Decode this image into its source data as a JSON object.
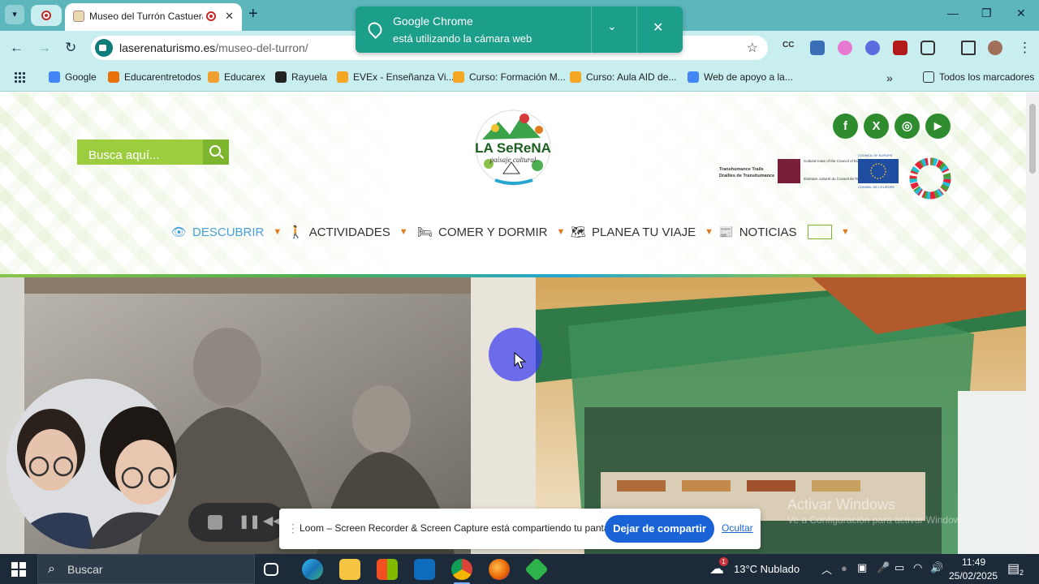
{
  "browser": {
    "active_tab": {
      "title": "Museo del Turrón Castuera"
    },
    "url": {
      "domain": "laserenaturismo.es",
      "path": "/museo-del-turron/"
    },
    "notification": {
      "title": "Google Chrome",
      "text": "está utilizando la cámara web"
    },
    "bookmarks": [
      {
        "label": "Google",
        "color": "#4285f4"
      },
      {
        "label": "Educarentretodos",
        "color": "#e8710a"
      },
      {
        "label": "Educarex",
        "color": "#f0a030"
      },
      {
        "label": "Rayuela",
        "color": "#222222"
      },
      {
        "label": "EVEx - Enseñanza Vi...",
        "color": "#f5a623"
      },
      {
        "label": "Curso: Formación M...",
        "color": "#f5a623"
      },
      {
        "label": "Curso: Aula AID de...",
        "color": "#f5a623"
      },
      {
        "label": "Web de apoyo a la...",
        "color": "#4285f4"
      }
    ],
    "all_bookmarks": "Todos los marcadores"
  },
  "site": {
    "search_placeholder": "Busca aquí...",
    "logo": {
      "line1": "LA SeReNA",
      "line2": "paisaje cultural"
    },
    "partner_text": {
      "trails": "Transhumance Trails",
      "trails_fr": "Drailles de Transhumance",
      "route": "Cultural route of the Council of Europe",
      "route_fr": "Itinéraire culturel du Conseil de l'Europe",
      "coe": "COUNCIL OF EUROPE",
      "coe_fr": "CONSEIL DE L'EUROPE"
    },
    "nav": [
      {
        "label": "DESCUBRIR",
        "icon": "eye-icon"
      },
      {
        "label": "ACTIVIDADES",
        "icon": "hiker-icon"
      },
      {
        "label": "COMER Y DORMIR",
        "icon": "bed-icon"
      },
      {
        "label": "PLANEA TU VIAJE",
        "icon": "map-icon"
      },
      {
        "label": "NOTICIAS",
        "icon": "newspaper-icon"
      }
    ],
    "social": [
      "f",
      "X",
      "◎",
      "▶"
    ]
  },
  "loom": {
    "message": "Loom – Screen Recorder & Screen Capture está compartiendo tu pantalla.",
    "stop_label": "Dejar de compartir",
    "hide_label": "Ocultar"
  },
  "windows": {
    "activate_title": "Activar Windows",
    "activate_sub": "Ve a Configuración para activar Windows."
  },
  "taskbar": {
    "search": "Buscar",
    "weather_badge": "1",
    "weather": "13°C  Nublado",
    "time": "11:49",
    "date": "25/02/2025",
    "notif_count": "2"
  },
  "colors": {
    "accent_green": "#2e8b2e",
    "search_green": "#9ccd3e",
    "chrome_teal": "#5cb6bc",
    "loom_blue": "#1a63d6"
  }
}
